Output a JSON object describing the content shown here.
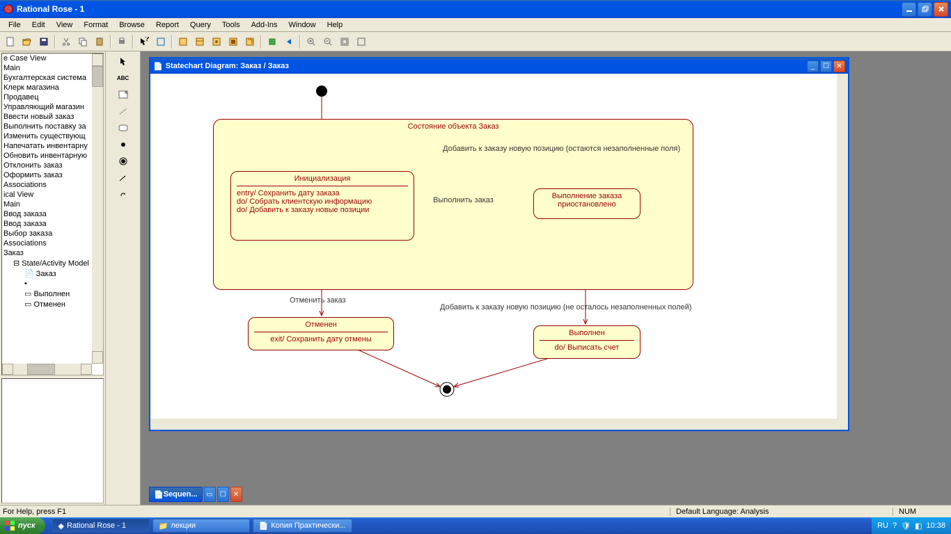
{
  "app": {
    "title": "Rational Rose  - 1"
  },
  "menu": {
    "file": "File",
    "edit": "Edit",
    "view": "View",
    "format": "Format",
    "browse": "Browse",
    "report": "Report",
    "query": "Query",
    "tools": "Tools",
    "addins": "Add-Ins",
    "window": "Window",
    "help": "Help"
  },
  "tree": {
    "items": [
      "e Case View",
      "Main",
      "Бухгалтерская система",
      "Клерк магазина",
      "Продавец",
      "Управляющий магазин",
      "Ввести новый заказ",
      "Выполнить поставку за",
      "Изменить существующ",
      "Напечатать инвентарну",
      "Обновить инвентарную",
      "Отклонить заказ",
      "Оформить заказ",
      "Associations",
      "ical View",
      "Main",
      "Ввод заказа",
      "Ввод заказа",
      "Выбор заказа",
      "Associations",
      "Заказ"
    ],
    "sub": {
      "model": "State/Activity Model",
      "zakaz": "Заказ",
      "dot": "•",
      "vypolnen": "Выполнен",
      "otmenen": "Отменен"
    }
  },
  "palette": {
    "abc": "ABC"
  },
  "child": {
    "title": "Statechart Diagram: Заказ / Заказ"
  },
  "diagram": {
    "composite_title": "Состояние объекта Заказ",
    "state_init": {
      "title": "Инициализация",
      "l1": "entry/ Сохранить дату заказа",
      "l2": "do/ Собрать клиентскую информацию",
      "l3": "do/ Добавить к заказу новые позиции"
    },
    "state_paused": {
      "l1": "Выполнение заказа",
      "l2": "приостановлено"
    },
    "state_cancel": {
      "title": "Отменен",
      "l1": "exit/ Сохранить дату отмены"
    },
    "state_done": {
      "title": "Выполнен",
      "l1": "do/ Выписать счет"
    },
    "labels": {
      "add_unfilled": "Добавить к заказу новую позицию (остаются незаполненные поля)",
      "execute": "Выполнить заказ",
      "cancel": "Отменить заказ",
      "add_filled": "Добавить к заказу новую позицию (не осталось незаполненных полей)"
    }
  },
  "minimized": {
    "title": "Sequen..."
  },
  "status": {
    "help": "For Help, press F1",
    "lang": "Default Language: Analysis",
    "num": "NUM"
  },
  "taskbar": {
    "start": "пуск",
    "t1": "Rational Rose - 1",
    "t2": "лекции",
    "t3": "Копия Практически...",
    "lang": "RU",
    "time": "10:38"
  }
}
